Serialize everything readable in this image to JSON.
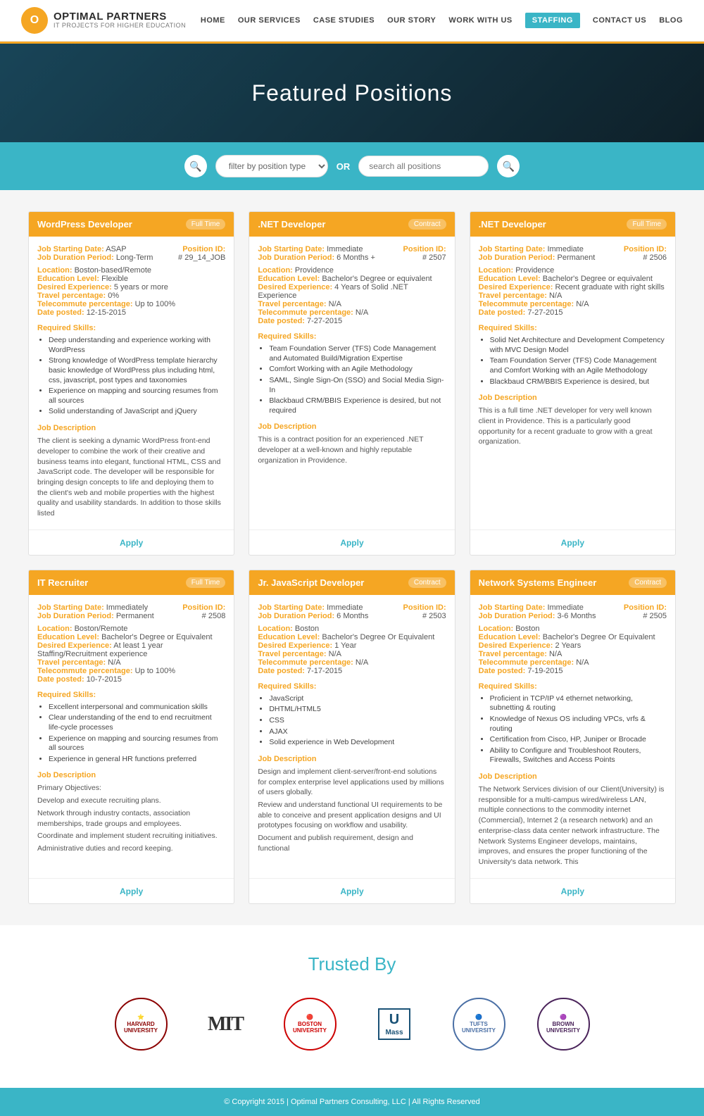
{
  "nav": {
    "links": [
      {
        "label": "HOME",
        "href": "#",
        "active": false
      },
      {
        "label": "OUR SERVICES",
        "href": "#",
        "active": false
      },
      {
        "label": "CASE STUDIES",
        "href": "#",
        "active": false
      },
      {
        "label": "OUR STORY",
        "href": "#",
        "active": false
      },
      {
        "label": "WORK WITH US",
        "href": "#",
        "active": false
      },
      {
        "label": "STAFFING",
        "href": "#",
        "active": true
      },
      {
        "label": "CONTACT US",
        "href": "#",
        "active": false
      },
      {
        "label": "BLOG",
        "href": "#",
        "active": false
      }
    ],
    "logo_brand": "OPTIMAL PARTNERS",
    "logo_sub": "IT PROJECTS FOR HIGHER EDUCATION"
  },
  "hero": {
    "title": "Featured Positions"
  },
  "search": {
    "filter_placeholder": "filter by position type",
    "search_placeholder": "search all positions",
    "or_label": "OR"
  },
  "jobs": [
    {
      "title": "WordPress Developer",
      "type": "Full Time",
      "start_label": "Job Starting Date:",
      "start_value": "ASAP",
      "position_id_label": "Position ID:",
      "position_id": "# 29_14_JOB",
      "duration_label": "Job Duration Period:",
      "duration_value": "Long-Term",
      "location_label": "Location:",
      "location_value": "Boston-based/Remote",
      "education_label": "Education Level:",
      "education_value": "Flexible",
      "experience_label": "Desired Experience:",
      "experience_value": "5 years or more",
      "travel_label": "Travel percentage:",
      "travel_value": "0%",
      "telecommute_label": "Telecommute percentage:",
      "telecommute_value": "Up to 100%",
      "date_label": "Date posted:",
      "date_value": "12-15-2015",
      "skills_label": "Required Skills:",
      "skills": [
        "Deep understanding and experience working with WordPress",
        "Strong knowledge of WordPress template hierarchy basic knowledge of WordPress plus including html, css, javascript, post types and taxonomies",
        "Experience on mapping and sourcing resumes from all sources",
        "Solid understanding of JavaScript and jQuery"
      ],
      "desc_label": "Job Description",
      "description": "The client is seeking a dynamic WordPress front-end developer to combine the work of their creative and business teams into elegant, functional HTML, CSS and JavaScript code. The developer will be responsible for bringing design concepts to life and deploying them to the client's web and mobile properties with the highest quality and usability standards. In addition to those skills listed",
      "apply_label": "Apply"
    },
    {
      "title": ".NET Developer",
      "type": "Contract",
      "start_label": "Job Starting Date:",
      "start_value": "Immediate",
      "position_id_label": "Position ID:",
      "position_id": "# 2507",
      "duration_label": "Job Duration Period:",
      "duration_value": "6 Months +",
      "location_label": "Location:",
      "location_value": "Providence",
      "education_label": "Education Level:",
      "education_value": "Bachelor's Degree or equivalent",
      "experience_label": "Desired Experience:",
      "experience_value": "4 Years of Solid .NET Experience",
      "travel_label": "Travel percentage:",
      "travel_value": "N/A",
      "telecommute_label": "Telecommute percentage:",
      "telecommute_value": "N/A",
      "date_label": "Date posted:",
      "date_value": "7-27-2015",
      "skills_label": "Required Skills:",
      "skills": [
        "Team Foundation Server (TFS) Code Management and Automated Build/Migration Expertise",
        "Comfort Working with an Agile Methodology",
        "SAML, Single Sign-On (SSO) and Social Media Sign-In",
        "Blackbaud CRM/BBIS Experience is desired, but not required"
      ],
      "desc_label": "Job Description",
      "description": "This is a contract position for an experienced .NET developer at a well-known and highly reputable organization in Providence.",
      "apply_label": "Apply"
    },
    {
      "title": ".NET Developer",
      "type": "Full Time",
      "start_label": "Job Starting Date:",
      "start_value": "Immediate",
      "position_id_label": "Position ID:",
      "position_id": "# 2506",
      "duration_label": "Job Duration Period:",
      "duration_value": "Permanent",
      "location_label": "Location:",
      "location_value": "Providence",
      "education_label": "Education Level:",
      "education_value": "Bachelor's Degree or equivalent",
      "experience_label": "Desired Experience:",
      "experience_value": "Recent graduate with right skills",
      "travel_label": "Travel percentage:",
      "travel_value": "N/A",
      "telecommute_label": "Telecommute percentage:",
      "telecommute_value": "N/A",
      "date_label": "Date posted:",
      "date_value": "7-27-2015",
      "skills_label": "Required Skills:",
      "skills": [
        "Solid Net Architecture and Development Competency with MVC Design Model",
        "Team Foundation Server (TFS) Code Management and Comfort Working with an Agile Methodology",
        "Blackbaud CRM/BBIS Experience is desired, but"
      ],
      "desc_label": "Job Description",
      "description": "This is a full time .NET developer for very well known client in Providence. This is a particularly good opportunity for a recent graduate to grow with a great organization.",
      "apply_label": "Apply"
    },
    {
      "title": "IT Recruiter",
      "type": "Full Time",
      "start_label": "Job Starting Date:",
      "start_value": "Immediately",
      "position_id_label": "Position ID:",
      "position_id": "# 2508",
      "duration_label": "Job Duration Period:",
      "duration_value": "Permanent",
      "location_label": "Location:",
      "location_value": "Boston/Remote",
      "education_label": "Education Level:",
      "education_value": "Bachelor's Degree or Equivalent",
      "experience_label": "Desired Experience:",
      "experience_value": "At least 1 year Staffing/Recruitment experience",
      "travel_label": "Travel percentage:",
      "travel_value": "N/A",
      "telecommute_label": "Telecommute percentage:",
      "telecommute_value": "Up to 100%",
      "date_label": "Date posted:",
      "date_value": "10-7-2015",
      "skills_label": "Required Skills:",
      "skills": [
        "Excellent interpersonal and communication skills",
        "Clear understanding of the end to end recruitment life-cycle processes",
        "Experience on mapping and sourcing resumes from all sources",
        "Experience in general HR functions preferred"
      ],
      "desc_label": "Job Description",
      "description": "Primary Objectives:\nDevelop and execute recruiting plans.\nNetwork through industry contacts, association memberships, trade groups and employees.\nCoordinate and implement student recruiting initiatives.\nAdministrative duties and record keeping.",
      "apply_label": "Apply"
    },
    {
      "title": "Jr. JavaScript Developer",
      "type": "Contract",
      "start_label": "Job Starting Date:",
      "start_value": "Immediate",
      "position_id_label": "Position ID:",
      "position_id": "# 2503",
      "duration_label": "Job Duration Period:",
      "duration_value": "6 Months",
      "location_label": "Location:",
      "location_value": "Boston",
      "education_label": "Education Level:",
      "education_value": "Bachelor's Degree Or Equivalent",
      "experience_label": "Desired Experience:",
      "experience_value": "1 Year",
      "travel_label": "Travel percentage:",
      "travel_value": "N/A",
      "telecommute_label": "Telecommute percentage:",
      "telecommute_value": "N/A",
      "date_label": "Date posted:",
      "date_value": "7-17-2015",
      "skills_label": "Required Skills:",
      "skills": [
        "JavaScript",
        "DHTML/HTML5",
        "CSS",
        "AJAX",
        "Solid experience in Web Development"
      ],
      "desc_label": "Job Description",
      "description": "Design and implement client-server/front-end solutions for complex enterprise level applications used by millions of users globally.\nReview and understand functional UI requirements to be able to conceive and present application designs and UI prototypes focusing on workflow and usability.\nDocument and publish requirement, design and functional",
      "apply_label": "Apply"
    },
    {
      "title": "Network Systems Engineer",
      "type": "Contract",
      "start_label": "Job Starting Date:",
      "start_value": "Immediate",
      "position_id_label": "Position ID:",
      "position_id": "# 2505",
      "duration_label": "Job Duration Period:",
      "duration_value": "3-6 Months",
      "location_label": "Location:",
      "location_value": "Boston",
      "education_label": "Education Level:",
      "education_value": "Bachelor's Degree Or Equivalent",
      "experience_label": "Desired Experience:",
      "experience_value": "2 Years",
      "travel_label": "Travel percentage:",
      "travel_value": "N/A",
      "telecommute_label": "Telecommute percentage:",
      "telecommute_value": "N/A",
      "date_label": "Date posted:",
      "date_value": "7-19-2015",
      "skills_label": "Required Skills:",
      "skills": [
        "Proficient in TCP/IP v4 ethernet networking, subnetting & routing",
        "Knowledge of Nexus OS including VPCs, vrfs & routing",
        "Certification from Cisco, HP, Juniper or Brocade",
        "Ability to Configure and Troubleshoot Routers, Firewalls, Switches and Access Points"
      ],
      "desc_label": "Job Description",
      "description": "The Network Services division of our Client(University) is responsible for a multi-campus wired/wireless LAN, multiple connections to the commodity internet (Commercial), Internet 2 (a research network) and an enterprise-class data center network infrastructure. The Network Systems Engineer develops, maintains, improves, and ensures the proper functioning of the University's data network. This",
      "apply_label": "Apply"
    }
  ],
  "trusted": {
    "title": "Trusted By",
    "logos": [
      {
        "name": "Harvard",
        "type": "circle"
      },
      {
        "name": "MIT",
        "type": "mit"
      },
      {
        "name": "BU",
        "type": "circle"
      },
      {
        "name": "UMass",
        "type": "umass"
      },
      {
        "name": "Tufts",
        "type": "circle"
      },
      {
        "name": "Brown",
        "type": "brown"
      }
    ]
  },
  "footer": {
    "text": "© Copyright 2015 | Optimal Partners Consulting, LLC | All Rights Reserved"
  }
}
